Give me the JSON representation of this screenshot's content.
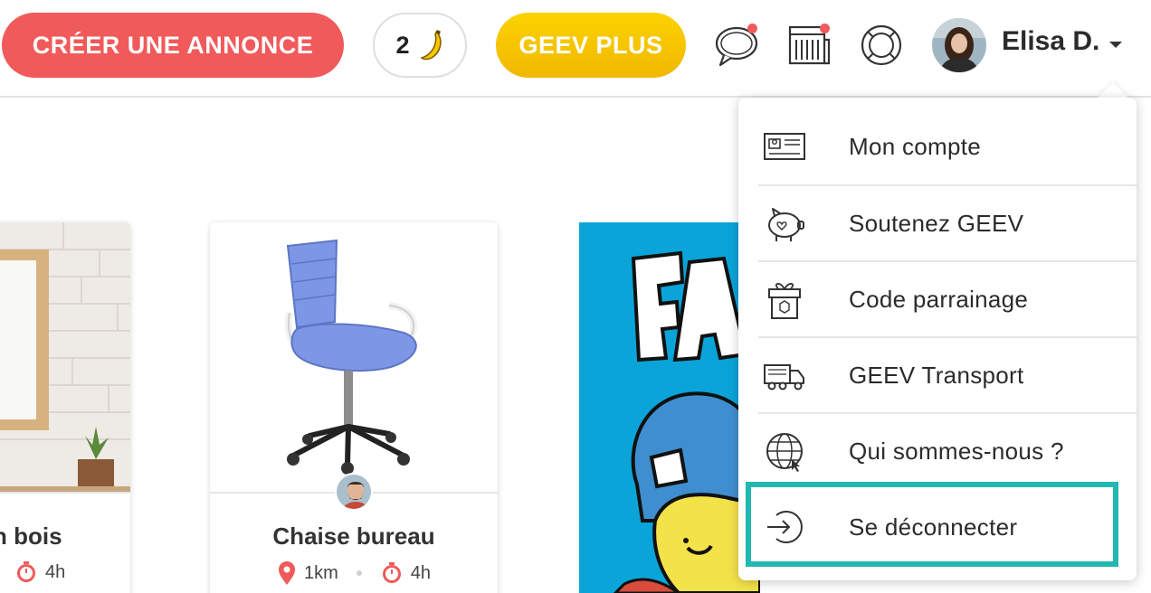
{
  "header": {
    "create_label": "CRÉER UNE ANNONCE",
    "banana_count": "2",
    "banana_icon": "banana-icon",
    "plus_label": "GEEV PLUS",
    "icons": [
      "chat-bubble-icon",
      "newspaper-icon",
      "lifebuoy-icon"
    ],
    "user_name": "Elisa D."
  },
  "cards": [
    {
      "title": "n bois",
      "time": "4h"
    },
    {
      "title": "Chaise bureau",
      "distance": "1km",
      "time": "4h"
    }
  ],
  "dropdown": {
    "items": [
      {
        "label": "Mon compte",
        "icon": "id-card-icon"
      },
      {
        "label": "Soutenez GEEV",
        "icon": "piggy-bank-icon"
      },
      {
        "label": "Code parrainage",
        "icon": "gift-icon"
      },
      {
        "label": "GEEV Transport",
        "icon": "truck-icon"
      },
      {
        "label": "Qui sommes-nous ?",
        "icon": "globe-icon"
      },
      {
        "label": "Se déconnecter",
        "icon": "logout-icon"
      }
    ]
  },
  "colors": {
    "create_button": "#f05a5a",
    "plus_button": "#f5c400",
    "notification_dot": "#f05a5a",
    "logout_highlight": "#22b8b0"
  }
}
